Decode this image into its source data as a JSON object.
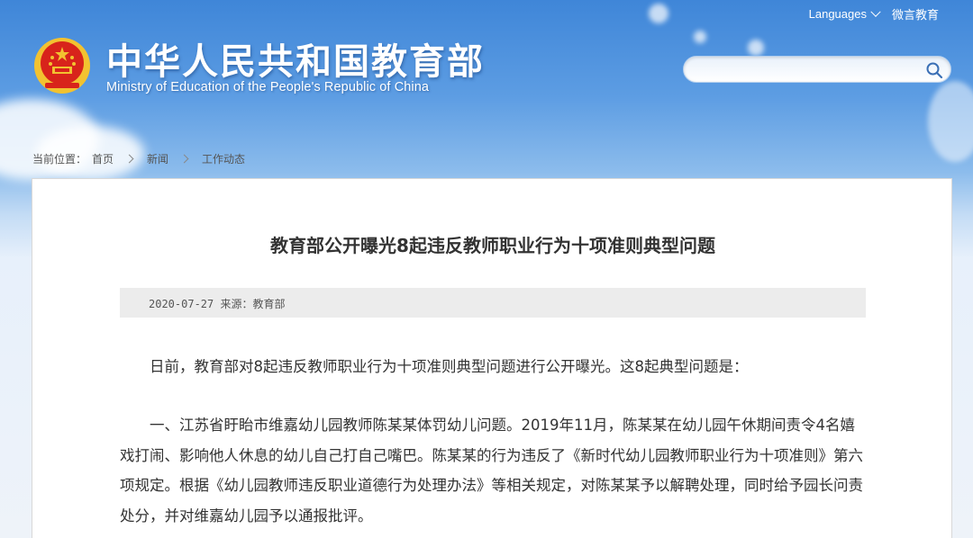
{
  "header": {
    "site_title": "中华人民共和国教育部",
    "site_subtitle": "Ministry of Education of the People's Republic of China",
    "top_links": {
      "languages": "Languages",
      "weibo": "微言教育"
    },
    "search": {
      "placeholder": ""
    }
  },
  "breadcrumb": {
    "prefix": "当前位置：",
    "items": [
      "首页",
      "新闻",
      "工作动态"
    ]
  },
  "article": {
    "title": "教育部公开曝光8起违反教师职业行为十项准则典型问题",
    "meta": "2020-07-27  来源：教育部",
    "paragraphs": [
      "日前，教育部对8起违反教师职业行为十项准则典型问题进行公开曝光。这8起典型问题是：",
      "一、江苏省盱眙市维嘉幼儿园教师陈某某体罚幼儿问题。2019年11月，陈某某在幼儿园午休期间责令4名嬉戏打闹、影响他人休息的幼儿自己打自己嘴巴。陈某某的行为违反了《新时代幼儿园教师职业行为十项准则》第六项规定。根据《幼儿园教师违反职业道德行为处理办法》等相关规定，对陈某某予以解聘处理，同时给予园长问责处分，并对维嘉幼儿园予以通报批评。"
    ]
  },
  "colors": {
    "sky_top": "#3f86d8",
    "page_bg": "#eef3f9",
    "emblem_red": "#d8231b",
    "emblem_gold": "#f2c230"
  }
}
